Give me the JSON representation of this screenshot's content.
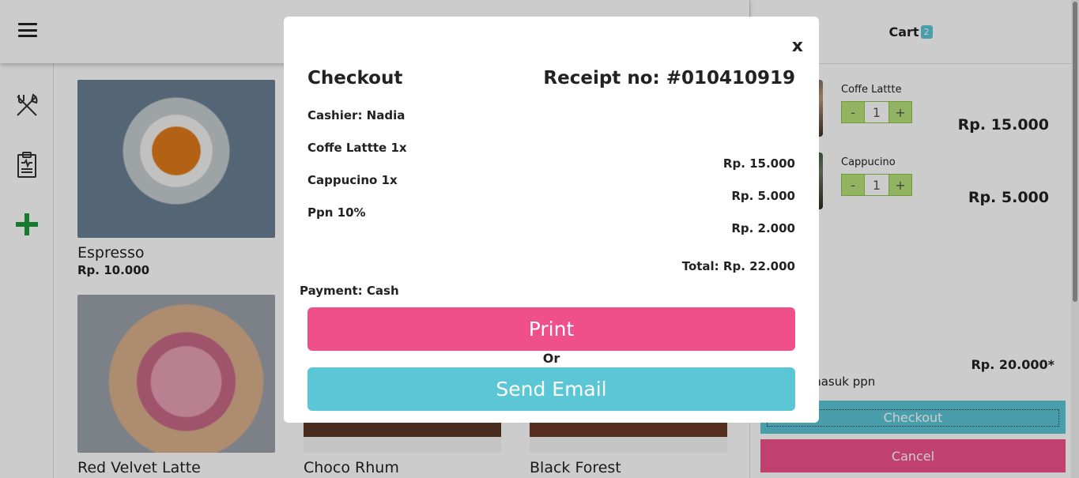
{
  "colors": {
    "accent_pink": "#f0508a",
    "accent_teal": "#5bc6d6",
    "qty_green": "#8bc34a",
    "add_icon_green": "#1a9a3a"
  },
  "header": {
    "menu_icon": "hamburger-menu-icon"
  },
  "sidebar": {
    "items": [
      {
        "icon": "utensils-icon"
      },
      {
        "icon": "clipboard-icon"
      },
      {
        "icon": "add-icon"
      }
    ]
  },
  "products": [
    {
      "name": "Espresso",
      "price": "Rp. 10.000"
    },
    {
      "name": "Red Velvet Latte",
      "price": ""
    },
    {
      "name": "Choco Rhum",
      "price": ""
    },
    {
      "name": "Black Forest",
      "price": ""
    }
  ],
  "cart": {
    "title": "Cart",
    "count": "2",
    "items": [
      {
        "name": "Coffe Lattte",
        "qty": "1",
        "minus": "-",
        "plus": "+",
        "price": "Rp. 15.000"
      },
      {
        "name": "Cappucino",
        "qty": "1",
        "minus": "-",
        "plus": "+",
        "price": "Rp. 5.000"
      }
    ],
    "subtotal": "Rp. 20.000*",
    "ppn_note": "ermasuk ppn",
    "checkout_label": "Checkout",
    "cancel_label": "Cancel"
  },
  "modal": {
    "close": "x",
    "title": "Checkout",
    "receipt": "Receipt no: #010410919",
    "cashier": "Cashier: Nadia",
    "lines": [
      {
        "label": "Coffe Lattte 1x",
        "amount": "Rp. 15.000"
      },
      {
        "label": "Cappucino 1x",
        "amount": "Rp. 5.000"
      },
      {
        "label": "Ppn 10%",
        "amount": "Rp. 2.000"
      }
    ],
    "total": "Total: Rp. 22.000",
    "payment": "Payment: Cash",
    "print_label": "Print",
    "or_label": "Or",
    "email_label": "Send Email"
  }
}
